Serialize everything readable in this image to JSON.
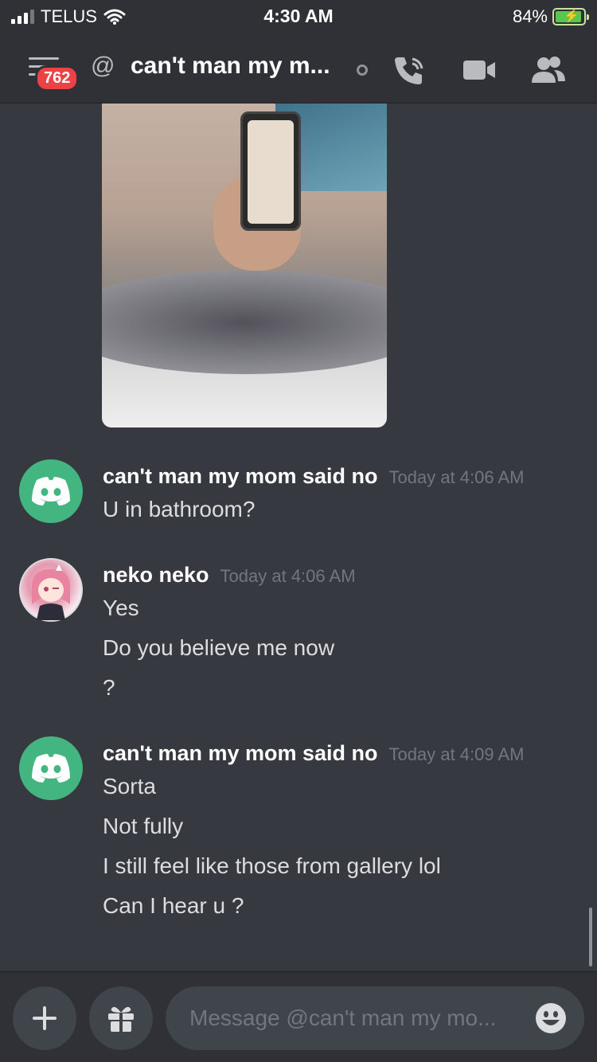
{
  "status_bar": {
    "carrier": "TELUS",
    "time": "4:30 AM",
    "battery_percent": "84%"
  },
  "header": {
    "badge_count": "762",
    "channel_name": "can't man my m..."
  },
  "messages": [
    {
      "username": "can't man my mom said no",
      "timestamp": "Today at 4:06 AM",
      "lines": [
        "U in bathroom?"
      ]
    },
    {
      "username": "neko neko",
      "timestamp": "Today at 4:06 AM",
      "lines": [
        "Yes",
        "Do you believe me now",
        "?"
      ]
    },
    {
      "username": "can't man my mom said no",
      "timestamp": "Today at 4:09 AM",
      "lines": [
        "Sorta",
        "Not fully",
        "I still feel like those from gallery lol",
        "Can I hear u ?"
      ]
    }
  ],
  "composer": {
    "placeholder": "Message @can't man my mo..."
  },
  "colors": {
    "background": "#36393f",
    "header": "#2f3136",
    "badge": "#ed4245",
    "discord_avatar": "#43b581"
  },
  "icons": [
    "menu-icon",
    "at-icon",
    "call-icon",
    "video-icon",
    "members-icon",
    "plus-icon",
    "gift-icon",
    "emoji-icon"
  ]
}
